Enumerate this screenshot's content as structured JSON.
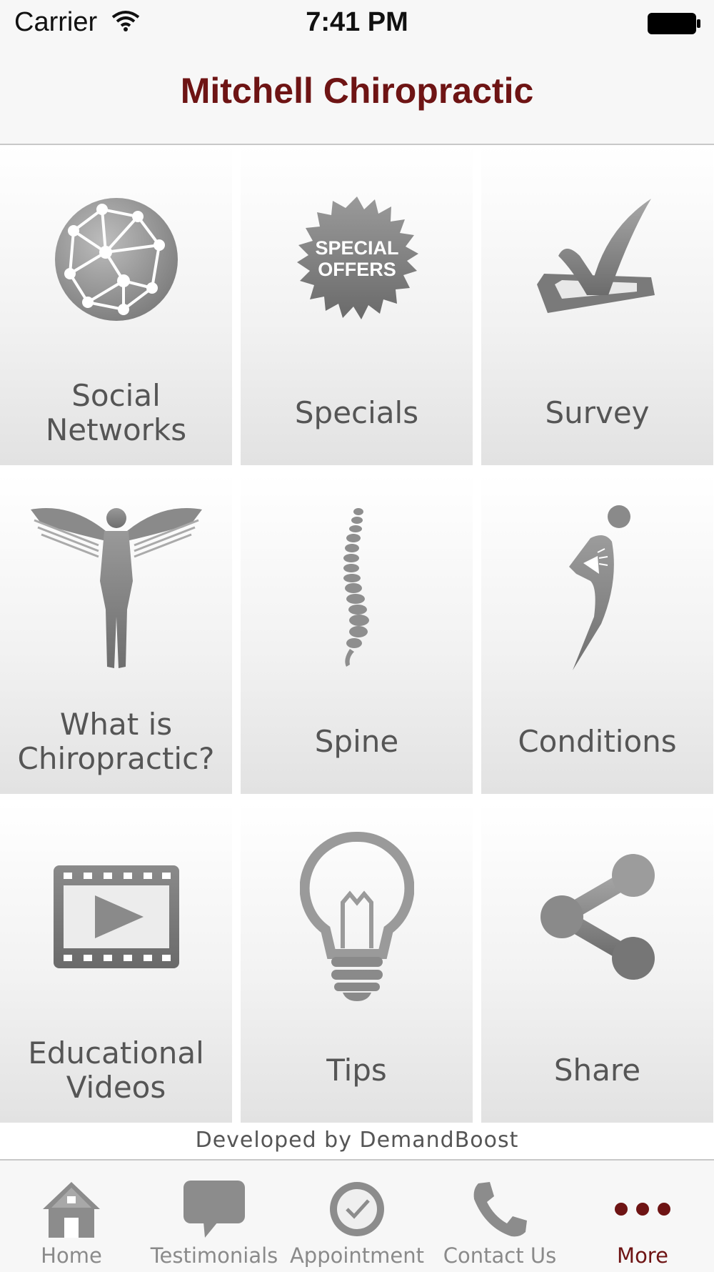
{
  "status_bar": {
    "carrier": "Carrier",
    "time": "7:41 PM"
  },
  "header": {
    "title": "Mitchell Chiropractic"
  },
  "tiles": [
    {
      "label": "Social\nNetworks",
      "icon": "globe-network-icon"
    },
    {
      "label": "Specials",
      "icon": "special-offers-badge-icon",
      "badge_text_1": "SPECIAL",
      "badge_text_2": "OFFERS"
    },
    {
      "label": "Survey",
      "icon": "checkmark-box-icon"
    },
    {
      "label": "What is\nChiropractic?",
      "icon": "winged-figure-icon"
    },
    {
      "label": "Spine",
      "icon": "spine-icon"
    },
    {
      "label": "Conditions",
      "icon": "back-pain-figure-icon"
    },
    {
      "label": "Educational\nVideos",
      "icon": "film-play-icon"
    },
    {
      "label": "Tips",
      "icon": "light-bulb-icon"
    },
    {
      "label": "Share",
      "icon": "share-icon"
    }
  ],
  "footer": {
    "credit": "Developed by DemandBoost"
  },
  "tab_bar": {
    "tabs": [
      {
        "label": "Home",
        "icon": "home-icon",
        "active": false
      },
      {
        "label": "Testimonials",
        "icon": "speech-bubble-icon",
        "active": false
      },
      {
        "label": "Appointment",
        "icon": "clock-check-icon",
        "active": false
      },
      {
        "label": "Contact Us",
        "icon": "phone-icon",
        "active": false
      },
      {
        "label": "More",
        "icon": "more-dots-icon",
        "active": true
      }
    ]
  },
  "colors": {
    "brand": "#6e1414",
    "icon_gray": "#8c8c8c",
    "label_gray": "#555555"
  }
}
